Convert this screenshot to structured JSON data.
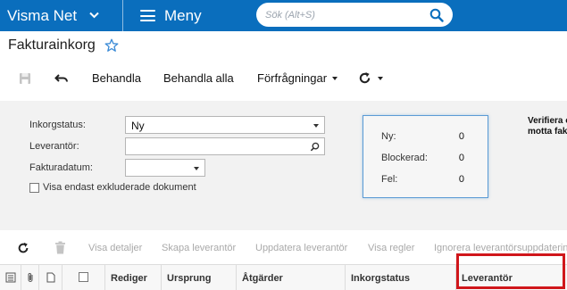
{
  "topbar": {
    "brand": "Visma Net",
    "menu_label": "Meny",
    "search_placeholder": "Sök (Alt+S)",
    "bg_color": "#0a6ebd"
  },
  "page": {
    "title": "Fakturainkorg"
  },
  "toolbar": {
    "save_icon": "save-icon",
    "undo_icon": "undo-icon",
    "process": "Behandla",
    "process_all": "Behandla alla",
    "inquiries": "Förfrågningar",
    "refresh_icon": "refresh-icon"
  },
  "filters": {
    "inbox_status_label": "Inkorgstatus:",
    "inbox_status_value": "Ny",
    "supplier_label": "Leverantör:",
    "supplier_value": "",
    "invoice_date_label": "Fakturadatum:",
    "invoice_date_value": "",
    "excluded_label": "Visa endast exkluderade dokument",
    "excluded_checked": false
  },
  "stats": {
    "new_label": "Ny:",
    "new_value": "0",
    "blocked_label": "Blockerad:",
    "blocked_value": "0",
    "error_label": "Fel:",
    "error_value": "0"
  },
  "verify_text": {
    "line1": "Verifiera e",
    "line2": "motta fak"
  },
  "grid_toolbar": {
    "view_details": "Visa detaljer",
    "create_supplier": "Skapa leverantör",
    "update_supplier": "Uppdatera leverantör",
    "view_rules": "Visa regler",
    "ignore_supplier_updates": "Ignorera leverantörsuppdatering"
  },
  "columns": {
    "edit": "Rediger",
    "origin": "Ursprung",
    "actions": "Åtgärder",
    "inbox_status": "Inkorgstatus",
    "supplier": "Leverantör"
  },
  "highlight_color": "#d0161b"
}
